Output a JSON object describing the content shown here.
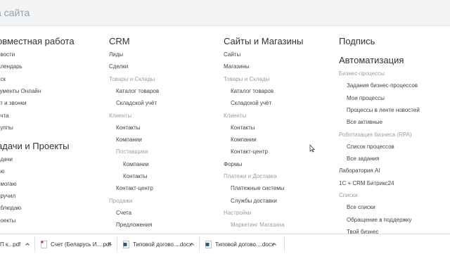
{
  "search": {
    "text": "а сайта"
  },
  "columns": [
    {
      "heading1": "овместная работа",
      "items1": [
        "овости",
        "алендарь",
        "иск",
        "кументы Онлайн",
        "ат и звонки",
        "очта",
        "руппы"
      ],
      "heading2": "адачи и Проекты",
      "items2": [
        "адачи",
        "аю",
        "омогаю",
        "оручил",
        "аблюдаю",
        "роекты"
      ]
    },
    {
      "heading": "CRM",
      "items": [
        {
          "t": "Лиды",
          "c": "n",
          "i": 0
        },
        {
          "t": "Сделки",
          "c": "n",
          "i": 0
        },
        {
          "t": "Товары и Склады",
          "c": "g",
          "i": 0
        },
        {
          "t": "Каталог товаров",
          "c": "n",
          "i": 1
        },
        {
          "t": "Складской учёт",
          "c": "n",
          "i": 1
        },
        {
          "t": "Клиенты",
          "c": "g",
          "i": 0
        },
        {
          "t": "Контакты",
          "c": "n",
          "i": 1
        },
        {
          "t": "Компании",
          "c": "n",
          "i": 1
        },
        {
          "t": "Поставщики",
          "c": "g",
          "i": 1
        },
        {
          "t": "Компании",
          "c": "n",
          "i": 2
        },
        {
          "t": "Контакты",
          "c": "n",
          "i": 2
        },
        {
          "t": "Контакт-центр",
          "c": "n",
          "i": 1
        },
        {
          "t": "Продажи",
          "c": "g",
          "i": 0
        },
        {
          "t": "Счета",
          "c": "n",
          "i": 1
        },
        {
          "t": "Предложения",
          "c": "n",
          "i": 1
        }
      ]
    },
    {
      "heading": "Сайты и Магазины",
      "items": [
        {
          "t": "Сайты",
          "c": "n",
          "i": 0
        },
        {
          "t": "Магазины",
          "c": "n",
          "i": 0
        },
        {
          "t": "Товары и Склады",
          "c": "g",
          "i": 0
        },
        {
          "t": "Каталог товаров",
          "c": "n",
          "i": 1
        },
        {
          "t": "Складской учёт",
          "c": "n",
          "i": 1
        },
        {
          "t": "Клиенты",
          "c": "g",
          "i": 0
        },
        {
          "t": "Контакты",
          "c": "n",
          "i": 1
        },
        {
          "t": "Компании",
          "c": "n",
          "i": 1
        },
        {
          "t": "Контакт-центр",
          "c": "n",
          "i": 1
        },
        {
          "t": "Формы",
          "c": "n",
          "i": 0
        },
        {
          "t": "Платежи и Доставка",
          "c": "g",
          "i": 0
        },
        {
          "t": "Платежные системы",
          "c": "n",
          "i": 1
        },
        {
          "t": "Службы доставки",
          "c": "n",
          "i": 1
        },
        {
          "t": "Настройки",
          "c": "g",
          "i": 0
        },
        {
          "t": "Маркетинг Магазина",
          "c": "g",
          "i": 1
        }
      ]
    },
    {
      "heading1": "Подпись",
      "heading2": "Автоматизация",
      "items": [
        {
          "t": "Бизнес-процессы",
          "c": "g",
          "i": 0
        },
        {
          "t": "Задания бизнес-процессов",
          "c": "n",
          "i": 1
        },
        {
          "t": "Мои процессы",
          "c": "n",
          "i": 1
        },
        {
          "t": "Процессы в ленте новостей",
          "c": "n",
          "i": 1
        },
        {
          "t": "Все активные",
          "c": "n",
          "i": 1
        },
        {
          "t": "Роботизация бизнеса (RPA)",
          "c": "g",
          "i": 0
        },
        {
          "t": "Список процессов",
          "c": "n",
          "i": 1
        },
        {
          "t": "Все задания",
          "c": "n",
          "i": 1
        },
        {
          "t": "Лаборатория AI",
          "c": "n",
          "i": 0
        },
        {
          "t": "1С + CRM Битрикс24",
          "c": "n",
          "i": 0
        },
        {
          "t": "Списки",
          "c": "g",
          "i": 0
        },
        {
          "t": "Все списки",
          "c": "n",
          "i": 1
        },
        {
          "t": "Обращение в поддержку",
          "c": "n",
          "i": 1
        },
        {
          "t": "Твой бизнес",
          "c": "n",
          "i": 1
        }
      ]
    }
  ],
  "downloads": [
    {
      "name": "П к...pdf",
      "icon": "pdf-icon"
    },
    {
      "name": "Счет (Беларусь И....pdf",
      "icon": "pdf-icon"
    },
    {
      "name": "Типовой догово....docx",
      "icon": "word-icon"
    },
    {
      "name": "Типовой догово....docx",
      "icon": "word-icon"
    }
  ],
  "colors": {
    "grey": "#9aa0a6",
    "pdf": "#d93025",
    "word": "#2b579a"
  }
}
